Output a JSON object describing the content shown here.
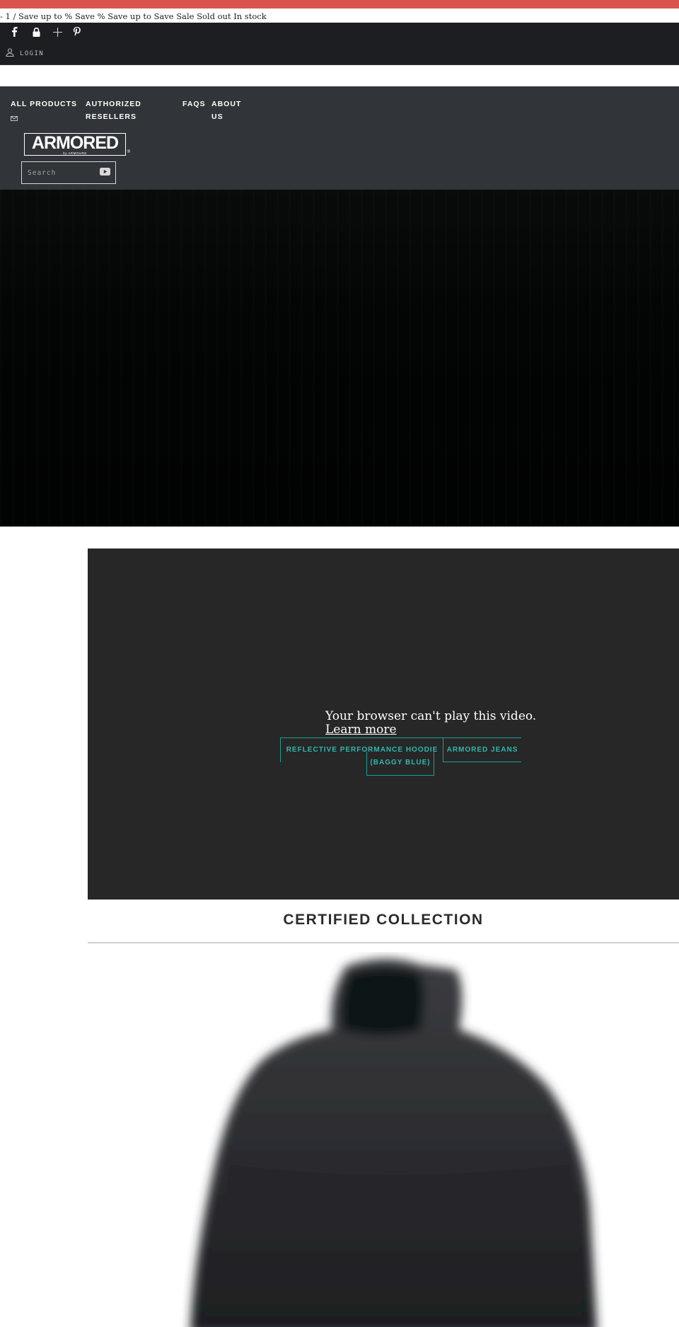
{
  "template_bar": {
    "text": "- 1 / Save up to % Save % Save up to Save Sale Sold out In stock",
    "color": "#d9534f"
  },
  "social": {
    "icons": [
      "facebook-icon",
      "lock-icon",
      "plus-icon",
      "pinterest-icon"
    ]
  },
  "account": {
    "login_label": "LOGIN"
  },
  "nav": {
    "all_products_label": "ALL PRODUCTS",
    "authorized_line1": "AUTHORIZED",
    "authorized_line2": "RESELLERS",
    "faqs_label": "FAQS",
    "about_line1": "ABOUT",
    "about_line2": "US"
  },
  "logo": {
    "text": "ARMORED",
    "subtext": "by ARMOURE",
    "registered": "®"
  },
  "search": {
    "placeholder": "Search"
  },
  "video": {
    "message": "Your browser can't play this video.",
    "link_text": "Learn more"
  },
  "featured_buttons": {
    "hoodie_line1": "REFLECTIVE PERFORMANCE HOODIE",
    "hoodie_line2": "(BAGGY BLUE)",
    "jeans": "ARMORED JEANS",
    "accent_color": "#1f9e95"
  },
  "collection": {
    "title": "CERTIFIED COLLECTION"
  }
}
